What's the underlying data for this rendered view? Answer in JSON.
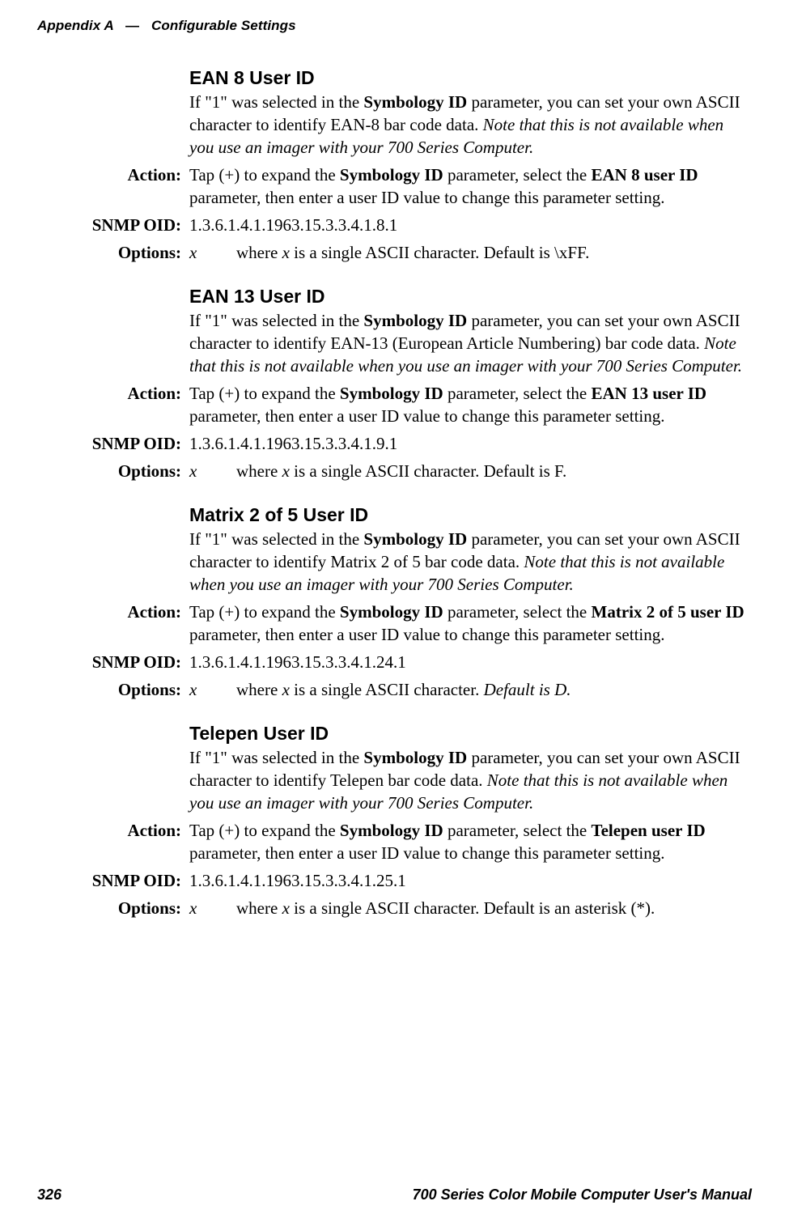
{
  "header": {
    "appendix": "Appendix",
    "letter": "A",
    "dash": "—",
    "title": "Configurable Settings"
  },
  "labels": {
    "action": "Action:",
    "snmp": "SNMP OID:",
    "options": "Options:"
  },
  "opt_sym": "x",
  "sections": [
    {
      "heading": "EAN 8 User ID",
      "intro_a": "If \"1\" was selected in the ",
      "intro_b": "Symbology ID",
      "intro_c": " parameter, you can set your own ASCII character to identify EAN-8 bar code data. ",
      "intro_i": "Note that this is not available when you use an imager with your 700 Series Computer.",
      "act_a": "Tap (+) to expand the ",
      "act_b": "Symbology ID",
      "act_c": " parameter, select the ",
      "act_d": "EAN 8 user ID",
      "act_e": " parameter, then enter a user ID value to change this parameter setting.",
      "oid": "1.3.6.1.4.1.1963.15.3.3.4.1.8.1",
      "opt_a": "where ",
      "opt_b": "x",
      "opt_c": " is a single ASCII character. Default is \\xFF.",
      "opt_c_italic": ""
    },
    {
      "heading": "EAN 13 User ID",
      "intro_a": "If \"1\" was selected in the ",
      "intro_b": "Symbology ID",
      "intro_c": " parameter, you can set your own ASCII character to identify EAN-13 (European Article Numbering) bar code data. ",
      "intro_i": "Note that this is not available when you use an imager with your 700 Series Computer.",
      "act_a": "Tap (+) to expand the ",
      "act_b": "Symbology ID",
      "act_c": " parameter, select the ",
      "act_d": "EAN 13 user ID",
      "act_e": " parameter, then enter a user ID value to change this parameter setting.",
      "oid": "1.3.6.1.4.1.1963.15.3.3.4.1.9.1",
      "opt_a": "where ",
      "opt_b": "x",
      "opt_c": " is a single ASCII character. Default is F.",
      "opt_c_italic": ""
    },
    {
      "heading": "Matrix 2 of 5 User ID",
      "intro_a": "If \"1\" was selected in the ",
      "intro_b": "Symbology ID",
      "intro_c": " parameter, you can set your own ASCII character to identify Matrix 2 of 5 bar code data. ",
      "intro_i": "Note that this is not available when you use an imager with your 700 Series Computer.",
      "act_a": "Tap (+) to expand the ",
      "act_b": "Symbology ID",
      "act_c": " parameter, select the ",
      "act_d": "Matrix 2 of 5 user ID",
      "act_e": " parameter, then enter a user ID value to change this parameter setting.",
      "oid": "1.3.6.1.4.1.1963.15.3.3.4.1.24.1",
      "opt_a": "where ",
      "opt_b": "x",
      "opt_c": " is a single ASCII character. ",
      "opt_c_italic": "Default is D."
    },
    {
      "heading": "Telepen User ID",
      "intro_a": "If \"1\" was selected in the ",
      "intro_b": "Symbology ID",
      "intro_c": " parameter, you can set your own ASCII character to identify Telepen bar code data. ",
      "intro_i": "Note that this is not available when you use an imager with your 700 Series Computer.",
      "act_a": "Tap (+) to expand the ",
      "act_b": "Symbology ID",
      "act_c": " parameter, select the ",
      "act_d": "Telepen user ID",
      "act_e": " parameter, then enter a user ID value to change this parameter setting.",
      "oid": "1.3.6.1.4.1.1963.15.3.3.4.1.25.1",
      "opt_a": "where ",
      "opt_b": "x",
      "opt_c": " is a single ASCII character. Default is an asterisk (*).",
      "opt_c_italic": ""
    }
  ],
  "footer": {
    "page": "326",
    "title": "700 Series Color Mobile Computer User's Manual"
  }
}
